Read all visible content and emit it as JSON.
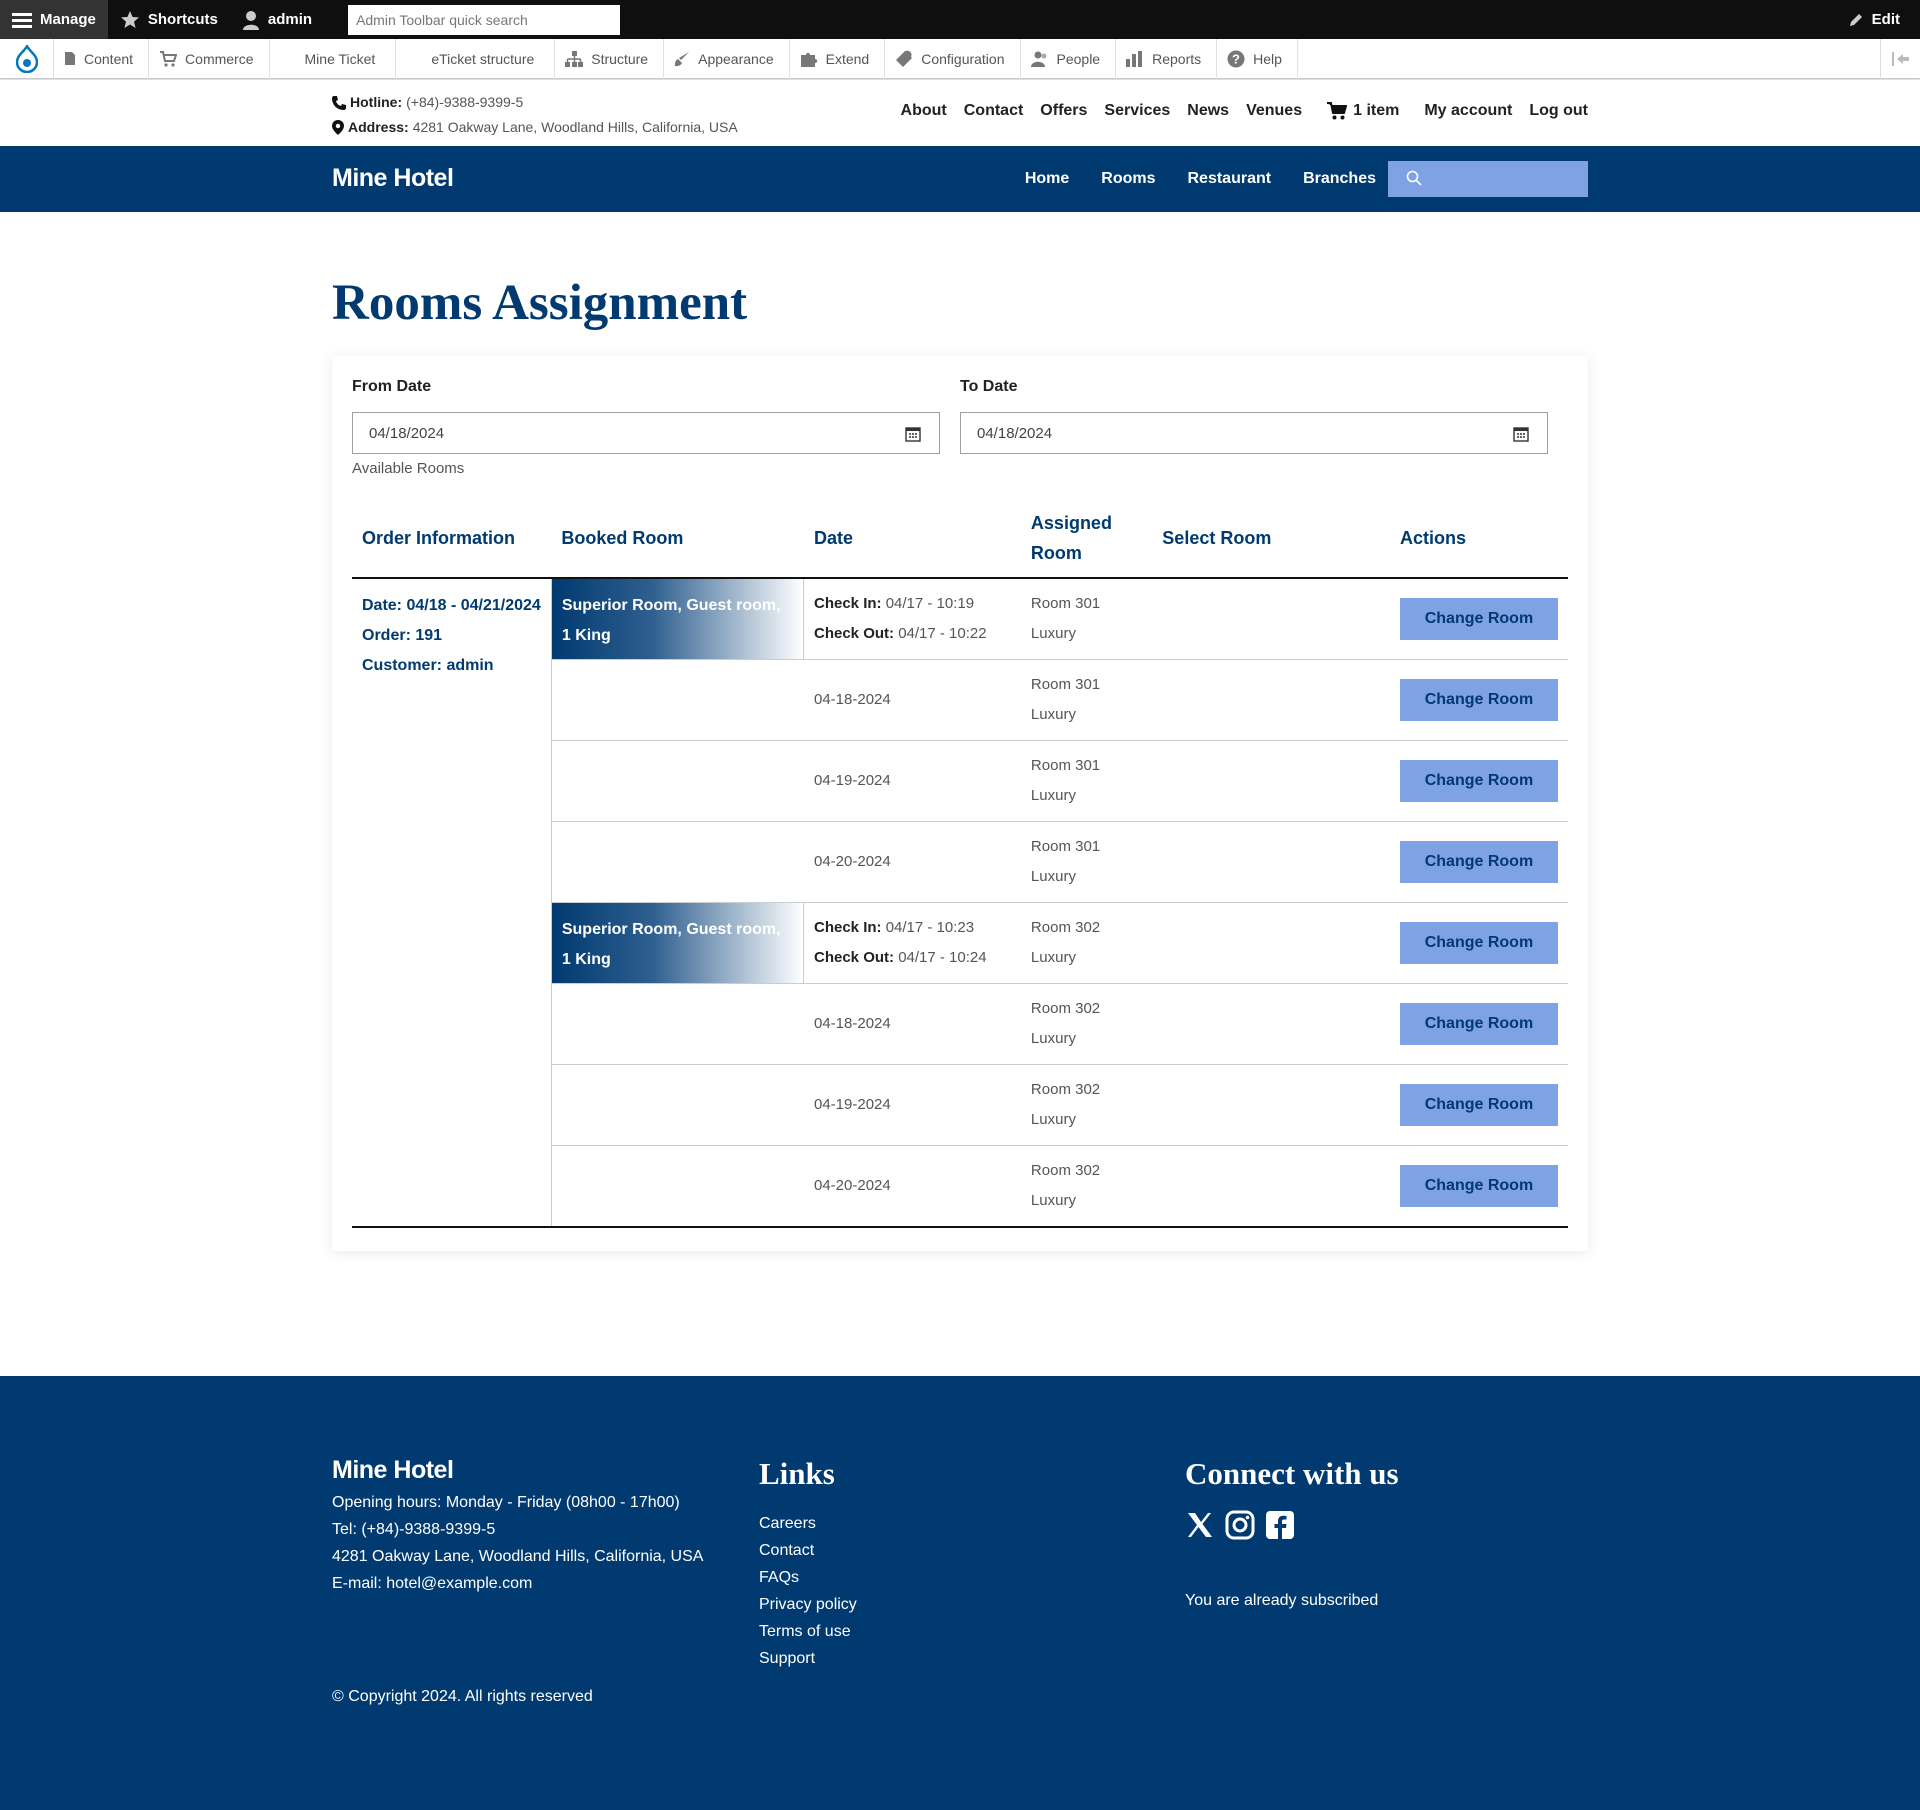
{
  "admin_toolbar": {
    "manage": "Manage",
    "shortcuts": "Shortcuts",
    "user": "admin",
    "search_placeholder": "Admin Toolbar quick search",
    "edit": "Edit"
  },
  "admin_tray": {
    "items": [
      "Content",
      "Commerce",
      "Mine Ticket",
      "eTicket structure",
      "Structure",
      "Appearance",
      "Extend",
      "Configuration",
      "People",
      "Reports",
      "Help"
    ]
  },
  "info_bar": {
    "hotline_label": "Hotline:",
    "hotline": "(+84)-9388-9399-5",
    "address_label": "Address:",
    "address": "4281 Oakway Lane, Woodland Hills, California, USA",
    "nav": [
      "About",
      "Contact",
      "Offers",
      "Services",
      "News",
      "Venues"
    ],
    "cart": "1 item",
    "my_account": "My account",
    "log_out": "Log out"
  },
  "main_nav": {
    "brand": "Mine Hotel",
    "links": [
      "Home",
      "Rooms",
      "Restaurant",
      "Branches"
    ]
  },
  "page": {
    "title": "Rooms Assignment",
    "from_label": "From Date",
    "from_value": "04/18/2024",
    "to_label": "To Date",
    "to_value": "04/18/2024",
    "available_rooms": "Available Rooms"
  },
  "table": {
    "headers": [
      "Order Information",
      "Booked Room",
      "Date",
      "Assigned Room",
      "Select Room",
      "Actions"
    ],
    "order": {
      "date": "Date: 04/18 - 04/21/2024",
      "order": "Order: 191",
      "customer": "Customer: admin"
    },
    "check_in_label": "Check In:",
    "check_out_label": "Check Out:",
    "action_label": "Change Room",
    "rows": [
      {
        "booked": "Superior Room, Guest room, 1 King",
        "check_in": "04/17 - 10:19",
        "check_out": "04/17 - 10:22",
        "date": "",
        "room": "Room 301",
        "type": "Luxury"
      },
      {
        "booked": "",
        "date": "04-18-2024",
        "room": "Room 301",
        "type": "Luxury"
      },
      {
        "booked": "",
        "date": "04-19-2024",
        "room": "Room 301",
        "type": "Luxury"
      },
      {
        "booked": "",
        "date": "04-20-2024",
        "room": "Room 301",
        "type": "Luxury"
      },
      {
        "booked": "Superior Room, Guest room, 1 King",
        "check_in": "04/17 - 10:23",
        "check_out": "04/17 - 10:24",
        "date": "",
        "room": "Room 302",
        "type": "Luxury"
      },
      {
        "booked": "",
        "date": "04-18-2024",
        "room": "Room 302",
        "type": "Luxury"
      },
      {
        "booked": "",
        "date": "04-19-2024",
        "room": "Room 302",
        "type": "Luxury"
      },
      {
        "booked": "",
        "date": "04-20-2024",
        "room": "Room 302",
        "type": "Luxury"
      }
    ]
  },
  "footer": {
    "brand": "Mine Hotel",
    "hours": "Opening hours: Monday - Friday (08h00 - 17h00)",
    "tel": "Tel: (+84)-9388-9399-5",
    "address": "4281 Oakway Lane, Woodland Hills, California, USA",
    "email": "E-mail: hotel@example.com",
    "links_title": "Links",
    "links": [
      "Careers",
      "Contact",
      "FAQs",
      "Privacy policy",
      "Terms of use",
      "Support"
    ],
    "connect_title": "Connect with us",
    "subscribed": "You are already subscribed",
    "copyright": "© Copyright 2024. All rights reserved"
  },
  "colors": {
    "navy": "#003a70",
    "button": "#7ea2e3"
  }
}
